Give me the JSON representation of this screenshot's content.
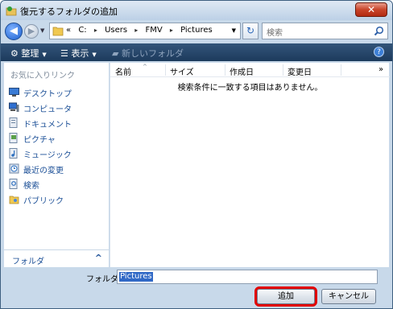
{
  "window": {
    "title": "復元するフォルダの追加",
    "close_label": "✕"
  },
  "address": {
    "back_label": "◀",
    "forward_label": "▶",
    "overflow": "«",
    "crumbs": [
      "C:",
      "Users",
      "FMV",
      "Pictures"
    ],
    "crumb_separator": "▸",
    "dropdown": "▼",
    "refresh": "↻"
  },
  "search": {
    "placeholder": "検索"
  },
  "toolbar": {
    "organize_label": "整理",
    "views_label": "表示",
    "new_folder_label": "新しいフォルダ",
    "caret": "▼",
    "help": "?"
  },
  "nav": {
    "header": "お気に入りリンク",
    "items": [
      {
        "label": "デスクトップ",
        "icon": "desktop-icon"
      },
      {
        "label": "コンピュータ",
        "icon": "computer-icon"
      },
      {
        "label": "ドキュメント",
        "icon": "documents-icon"
      },
      {
        "label": "ピクチャ",
        "icon": "pictures-icon"
      },
      {
        "label": "ミュージック",
        "icon": "music-icon"
      },
      {
        "label": "最近の変更",
        "icon": "recent-icon"
      },
      {
        "label": "検索",
        "icon": "search-folder-icon"
      },
      {
        "label": "パブリック",
        "icon": "public-icon"
      }
    ],
    "folders_label": "フォルダ",
    "folders_chevron": "^"
  },
  "list": {
    "columns": [
      "名前",
      "サイズ",
      "作成日",
      "変更日"
    ],
    "more": "»",
    "empty_message": "検索条件に一致する項目はありません。"
  },
  "footer": {
    "folder_label": "フォルダ:",
    "folder_value": "Pictures",
    "add_label": "追加",
    "cancel_label": "キャンセル"
  },
  "colors": {
    "highlight": "#e10000",
    "link": "#1a4e96",
    "toolbar": "#1c3a5c"
  }
}
